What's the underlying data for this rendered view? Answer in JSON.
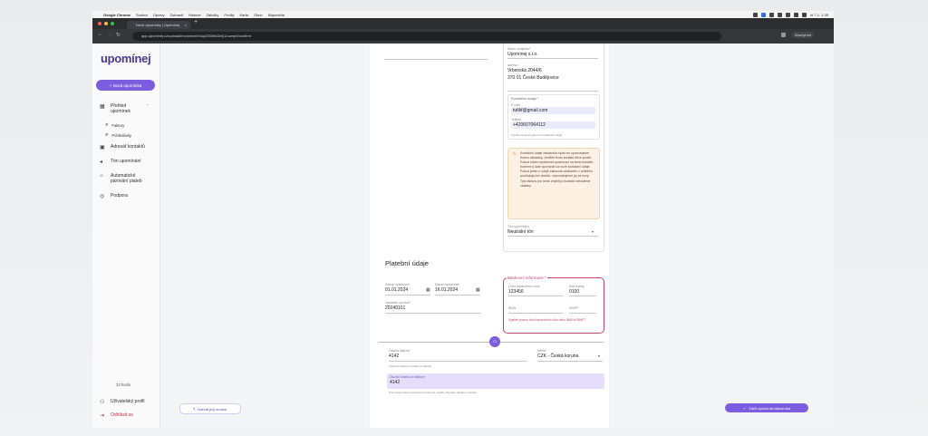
{
  "menubar": {
    "app": "Google Chrome",
    "items": [
      "Soubor",
      "Úpravy",
      "Zobrazit",
      "Historie",
      "Záložky",
      "Profily",
      "Karta",
      "Okno",
      "Nápověda"
    ],
    "clock": "čt 7.1. 1:35"
  },
  "browser": {
    "tab_title": "Nové upomínky | Upomínej",
    "url": "app.upominej.cz/upload/invoices/r0r1sq2003b63n0j1/uomp0/confirm",
    "profile": "Anonymní"
  },
  "sidebar": {
    "logo": "upomínej",
    "new_button": "+  Nová upomínka",
    "overview": "Přehled upomínek",
    "invoices": "Faktury",
    "receivables": "Pohledávky",
    "contacts": "Adresář kontaktů",
    "tone": "Tón upomínání",
    "auto_pair": "Automatické párování plateb",
    "support": "Podpora",
    "help": "33 hodin",
    "profile": "Uživatelský profil",
    "logout": "Odhlásit se"
  },
  "customer": {
    "name_label": "Název subjektu*",
    "name": "Upomínej s.r.o.",
    "address_label": "Adresa",
    "address1": "Vrbenská 2044/6",
    "address2": "370 01 České Budějovice",
    "contact_title": "Kontaktní údaje *",
    "email_label": "E-mail",
    "email": "tutlkf@gmail.com",
    "phone_label": "Telefon",
    "phone": "+420607064112",
    "contact_hint": "Vyplňte alespoň jeden z kontaktních údajů",
    "warning": "Kontaktní údaje zákazníka spolu se zpracováním budou ukládány. Jestliže tento kontakt dříve použil. Pokud může neplatnost upomínací na tento kontakt, budeme ji dále upomínat na nové kontaktní údaje. Pokud jeden z údajů zákazník odstraněn v průběhu prodlužujících období, nepovažujeme jej za nový. Tyto faktury pro tento chybějící kontakt nebudeme zaslány.",
    "tone_label": "Tón upomínání",
    "tone_value": "Neutrální tón"
  },
  "payment": {
    "title": "Platební údaje",
    "issue_label": "Datum vystavení*",
    "issue": "01.01.2024",
    "due_label": "Datum splatnosti*",
    "due": "16.01.2024",
    "vs_label": "Variabilní symbol*",
    "vs": "20240101",
    "bank_title": "Bankovní informace *",
    "account_label": "Číslo bankovního účtu",
    "account": "123456",
    "code_label": "Kód banky",
    "code": "0100",
    "iban_label": "IBAN",
    "swift_label": "SWIFT",
    "bank_hint": "Vyplňte prosím číslo bankovního účtu nebo IBAN a SWIFT",
    "amount_label": "Částka faktury*",
    "amount": "4142",
    "amount_hint": "Celková částka k úhradě na faktuře",
    "currency_label": "Měna*",
    "currency": "CZK - Česká koruna",
    "open_label": "Dlužná částka za faktury*",
    "open": "4142",
    "open_hint": "Pokud byla faktura částečně uhrazena, uveďte zbývající částku k úhradě"
  },
  "footer": {
    "back": "Nahrát jiný soubor",
    "submit": "Začít upomínat zákazníka"
  }
}
